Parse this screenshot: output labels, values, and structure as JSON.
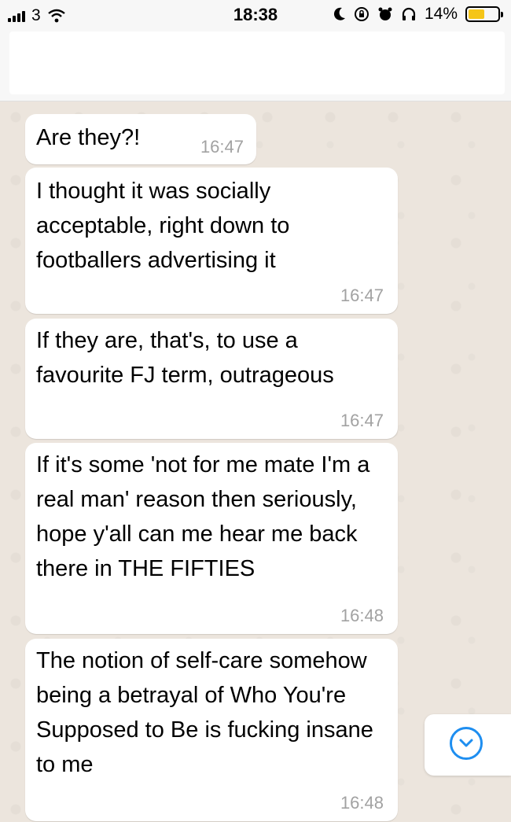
{
  "status_bar": {
    "carrier": "3",
    "time": "18:38",
    "battery_percent_label": "14%",
    "battery_level": 0.14,
    "icons": [
      "signal-icon",
      "wifi-icon",
      "moon-icon",
      "rotation-lock-icon",
      "alarm-icon",
      "headphones-icon",
      "battery-icon"
    ]
  },
  "messages": [
    {
      "text": "Are they?!",
      "time": "16:47"
    },
    {
      "text": "I thought it was socially acceptable, right down to footballers advertising it",
      "time": "16:47"
    },
    {
      "text": "If they are, that's, to use a favourite FJ term, outrageous",
      "time": "16:47"
    },
    {
      "text": "If it's some 'not for me mate I'm a real man' reason then seriously, hope y'all can me hear me back there in THE FIFTIES",
      "time": "16:48"
    },
    {
      "text": "The notion of self-care somehow being a betrayal of Who You're Supposed to Be is fucking insane to me",
      "time": "16:48"
    }
  ],
  "colors": {
    "bubble": "#ffffff",
    "chat_background": "#ece5dd",
    "timestamp": "#a2a2a2",
    "accent": "#1e8ef0",
    "battery": "#f5c518"
  }
}
